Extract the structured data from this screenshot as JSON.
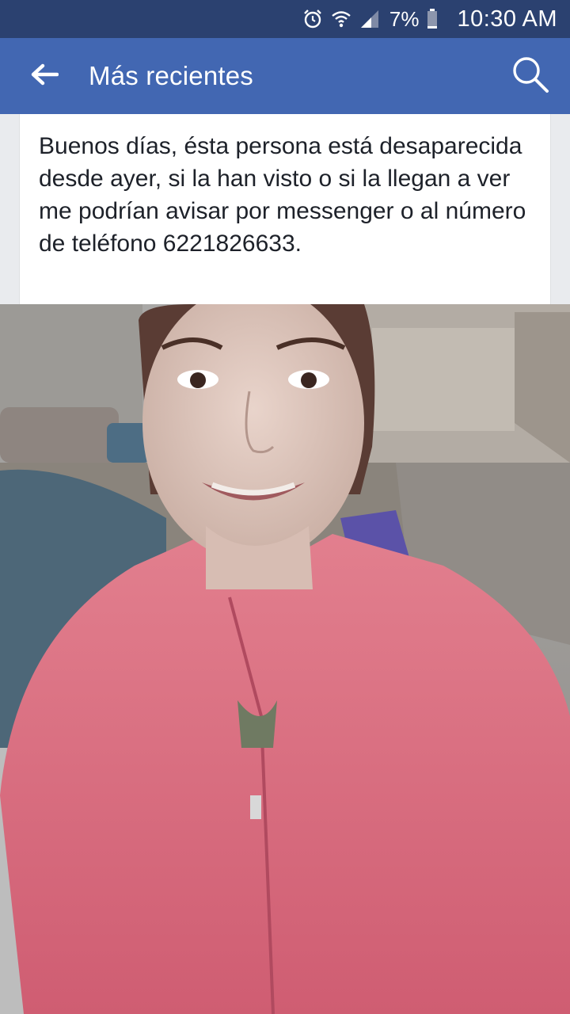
{
  "status_bar": {
    "battery": "7%",
    "time": "10:30 AM",
    "icons": [
      "alarm-icon",
      "wifi-icon",
      "signal-icon",
      "battery-icon"
    ]
  },
  "app_bar": {
    "title": "Más recientes",
    "icons": [
      "back-arrow-icon",
      "search-icon"
    ]
  },
  "post": {
    "text": "Buenos días, ésta persona está desaparecida desde ayer, si la han visto o si la llegan a ver me podrían avisar por messenger o al número de teléfono 6221826633."
  },
  "colors": {
    "status_bar": "#2b4170",
    "app_bar": "#4267b2",
    "background": "#e9ebee",
    "text": "#1d2129"
  }
}
